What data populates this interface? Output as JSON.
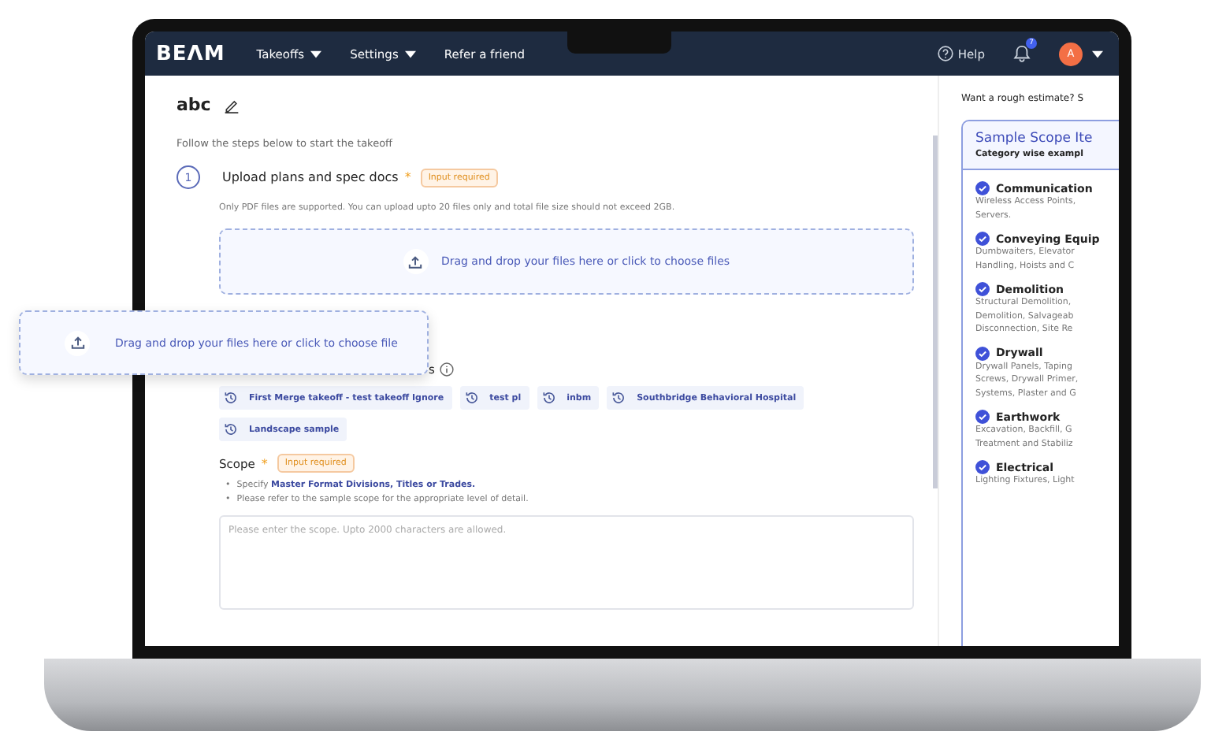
{
  "nav": {
    "logo": "BEΛM",
    "menus": [
      {
        "label": "Takeoffs",
        "dropdown": true
      },
      {
        "label": "Settings",
        "dropdown": true
      },
      {
        "label": "Refer a friend",
        "dropdown": false
      }
    ],
    "help": "Help",
    "notifications": "7",
    "avatar": "A"
  },
  "title": "abc",
  "subtitle": "Follow the steps below to start the takeoff",
  "step": {
    "number": "1",
    "title": "Upload plans and spec docs",
    "required": "*",
    "badge": "Input required",
    "note": "Only PDF files are supported. You can upload upto 20 files only and total file size should not exceed 2GB.",
    "dropzone": "Drag and drop your files here or click to choose files"
  },
  "drag_overlay": {
    "text": "Drag and drop your files here or click to choose file"
  },
  "recent": {
    "heading_tail": "s",
    "chips": [
      {
        "label": "First Merge takeoff - test takeoff Ignore"
      },
      {
        "label": "test pl"
      },
      {
        "label": "inbm"
      },
      {
        "label": "Southbridge Behavioral Hospital"
      },
      {
        "label": "Landscape sample"
      }
    ]
  },
  "scope": {
    "label": "Scope",
    "required": "*",
    "badge": "Input required",
    "bullets": [
      {
        "marker": "•",
        "text": "Specify ",
        "link": "Master Format Divisions, Titles or Trades."
      },
      {
        "marker": "•",
        "text": "Please refer to the sample scope for the appropriate level of detail."
      }
    ],
    "placeholder": "Please enter the scope. Upto 2000 characters are allowed."
  },
  "sidebar": {
    "prompt": "Want a rough estimate? S",
    "card_title": "Sample Scope Ite",
    "card_subtitle": "Category wise exampl",
    "categories": [
      {
        "name": "Communication",
        "lines": [
          "Wireless Access Points,",
          "Servers."
        ]
      },
      {
        "name": "Conveying Equip",
        "lines": [
          "Dumbwaiters, Elevator",
          "Handling, Hoists and C"
        ]
      },
      {
        "name": "Demolition",
        "lines": [
          "Structural Demolition,",
          "Demolition, Salvageab",
          "Disconnection, Site Re"
        ]
      },
      {
        "name": "Drywall",
        "lines": [
          "Drywall Panels, Taping",
          "Screws, Drywall Primer,",
          "Systems, Plaster and G"
        ]
      },
      {
        "name": "Earthwork",
        "lines": [
          "Excavation, Backfill, G",
          "Treatment and Stabiliz"
        ]
      },
      {
        "name": "Electrical",
        "lines": [
          "Lighting Fixtures, Light"
        ]
      }
    ]
  }
}
